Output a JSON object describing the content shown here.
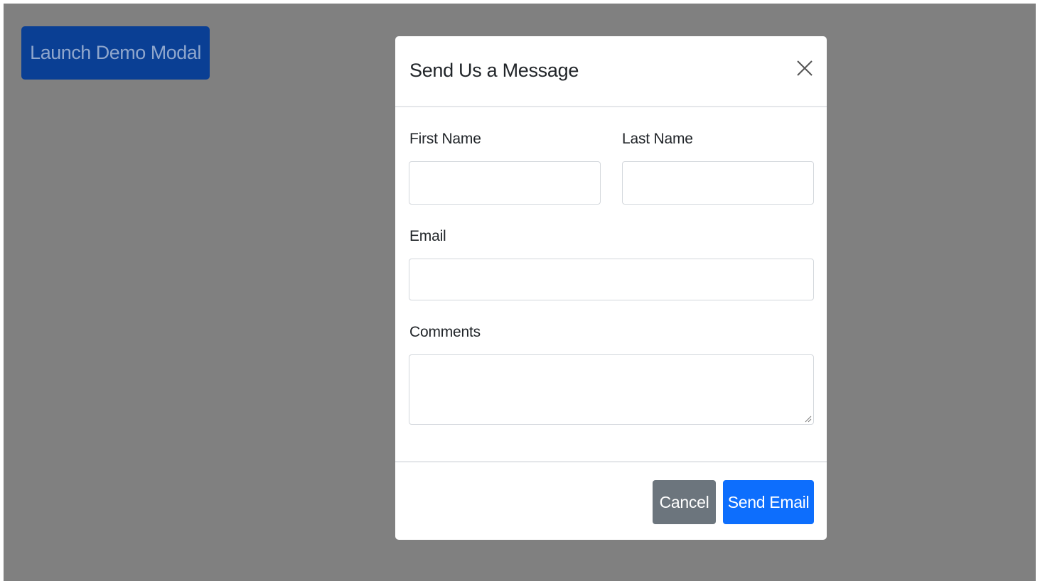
{
  "launch_button": {
    "label": "Launch Demo Modal"
  },
  "modal": {
    "title": "Send Us a Message",
    "close_icon": "close-icon",
    "fields": {
      "first_name": {
        "label": "First Name",
        "value": ""
      },
      "last_name": {
        "label": "Last Name",
        "value": ""
      },
      "email": {
        "label": "Email",
        "value": ""
      },
      "comments": {
        "label": "Comments",
        "value": ""
      }
    },
    "footer": {
      "cancel_label": "Cancel",
      "send_label": "Send Email"
    }
  },
  "colors": {
    "backdrop": "#808080",
    "launch_button_bg": "#0a3f94",
    "cancel_bg": "#6c757d",
    "primary": "#0d6efd"
  }
}
